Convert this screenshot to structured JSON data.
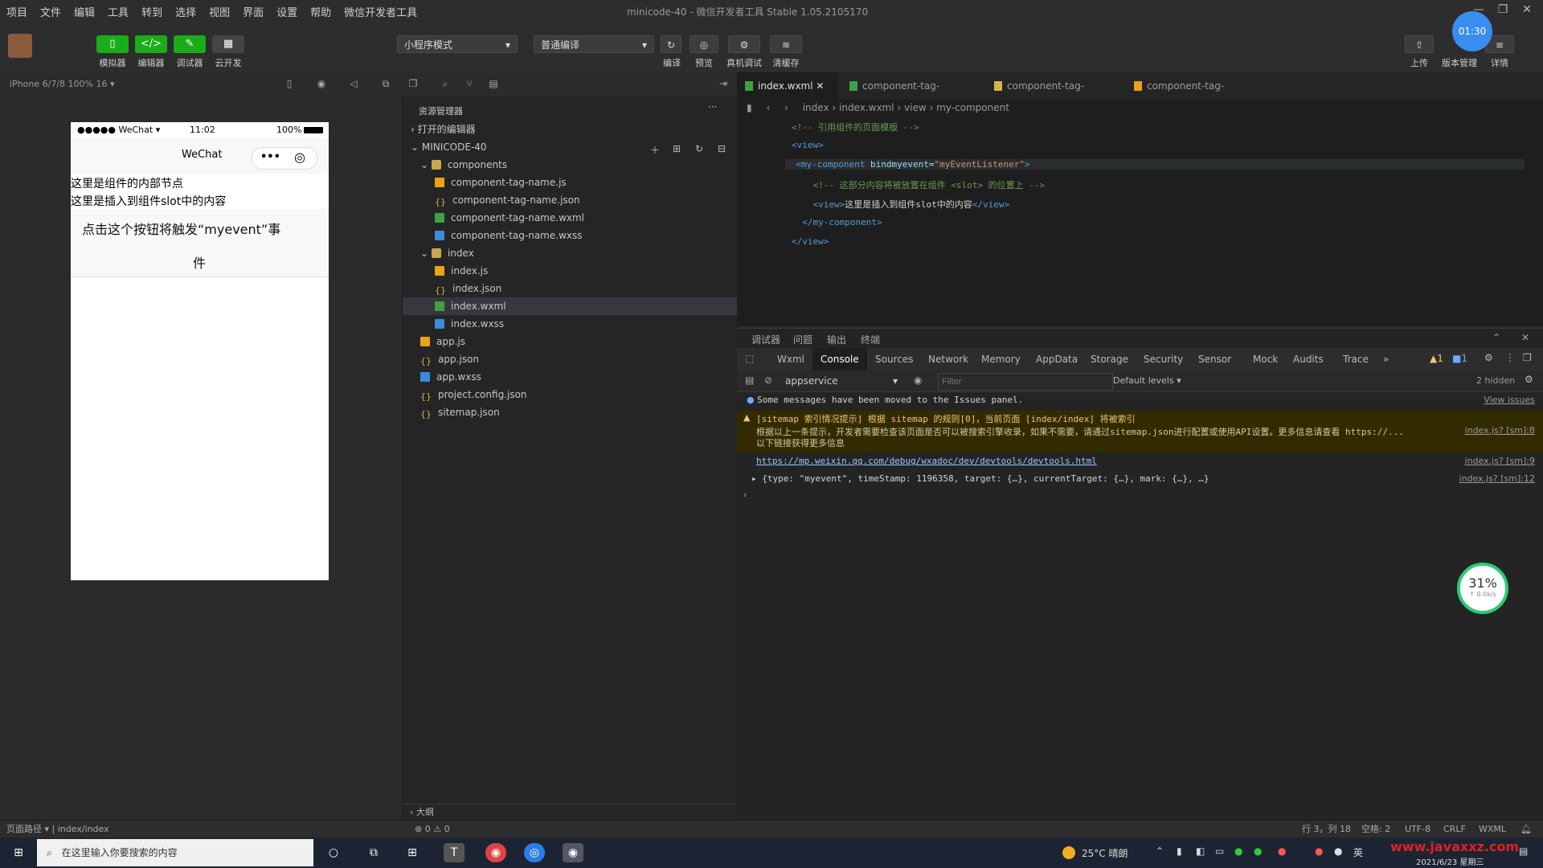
{
  "menubar": {
    "items": [
      "项目",
      "文件",
      "编辑",
      "工具",
      "转到",
      "选择",
      "视图",
      "界面",
      "设置",
      "帮助",
      "微信开发者工具"
    ],
    "window_title": "minicode-40 - 微信开发者工具 Stable 1.05.2105170"
  },
  "toolbar": {
    "buttons": [
      {
        "icon": "phone-icon",
        "label": "模拟器"
      },
      {
        "icon": "code-icon",
        "label": "编辑器"
      },
      {
        "icon": "debug-icon",
        "label": "调试器"
      },
      {
        "icon": "cloud-icon",
        "label": "云开发"
      }
    ],
    "mode_select": "小程序模式",
    "compile_select": "普通编译",
    "compile_label": "编译",
    "preview_label": "预览",
    "real_debug_label": "真机调试",
    "clear_cache_label": "清缓存",
    "upload_label": "上传",
    "version_label": "版本管理",
    "detail_label": "详情",
    "avatar_time": "01:30"
  },
  "subbar": {
    "device": "iPhone 6/7/8 100% 16 ▾"
  },
  "simulator": {
    "status_left": "●●●●● WeChat ▾",
    "status_time": "11:02",
    "status_right": "100%",
    "nav_title": "WeChat",
    "line1": "这里是组件的内部节点",
    "line2": "这里是插入到组件slot中的内容",
    "button_text_1": "点击这个按钮将触发“myevent”事",
    "button_text_2": "件"
  },
  "explorer": {
    "header": "资源管理器",
    "open_editors": "打开的编辑器",
    "project": "MINICODE-40",
    "tree": [
      {
        "label": "components",
        "type": "folder",
        "depth": 1
      },
      {
        "label": "component-tag-name.js",
        "type": "js",
        "depth": 2
      },
      {
        "label": "component-tag-name.json",
        "type": "json",
        "depth": 2
      },
      {
        "label": "component-tag-name.wxml",
        "type": "wxml",
        "depth": 2
      },
      {
        "label": "component-tag-name.wxss",
        "type": "wxss",
        "depth": 2
      },
      {
        "label": "index",
        "type": "folder",
        "depth": 1
      },
      {
        "label": "index.js",
        "type": "js",
        "depth": 2
      },
      {
        "label": "index.json",
        "type": "json",
        "depth": 2
      },
      {
        "label": "index.wxml",
        "type": "wxml",
        "depth": 2,
        "selected": true
      },
      {
        "label": "index.wxss",
        "type": "wxss",
        "depth": 2
      },
      {
        "label": "app.js",
        "type": "js",
        "depth": 1
      },
      {
        "label": "app.json",
        "type": "json",
        "depth": 1
      },
      {
        "label": "app.wxss",
        "type": "wxss",
        "depth": 1
      },
      {
        "label": "project.config.json",
        "type": "json",
        "depth": 1
      },
      {
        "label": "sitemap.json",
        "type": "json",
        "depth": 1
      }
    ],
    "outline": "大纲"
  },
  "editor": {
    "tabs": [
      {
        "label": "index.wxml",
        "type": "wxml",
        "active": true
      },
      {
        "label": "component-tag-name.wxml",
        "type": "wxml"
      },
      {
        "label": "component-tag-name.json",
        "type": "json"
      },
      {
        "label": "component-tag-name.js",
        "type": "js"
      }
    ],
    "breadcrumb": [
      "index",
      "index.wxml",
      "view",
      "my-component"
    ],
    "lines": [
      [
        {
          "t": "<!-- 引用组件的页面模版 -->",
          "c": "com"
        }
      ],
      [
        {
          "t": "<view>",
          "c": "tag"
        }
      ],
      [
        {
          "t": "  <my-component ",
          "c": "tag"
        },
        {
          "t": "bindmyevent",
          "c": "attr"
        },
        {
          "t": "=",
          "c": "txt"
        },
        {
          "t": "\"myEventListener\"",
          "c": "str"
        },
        {
          "t": ">",
          "c": "tag"
        }
      ],
      [
        {
          "t": "    <!-- 这部分内容将被放置在组件 <slot> 的位置上 -->",
          "c": "com"
        }
      ],
      [
        {
          "t": "    <view>",
          "c": "tag"
        },
        {
          "t": "这里是插入到组件slot中的内容",
          "c": "txt"
        },
        {
          "t": "</view>",
          "c": "tag"
        }
      ],
      [
        {
          "t": "  </my-component>",
          "c": "tag"
        }
      ],
      [
        {
          "t": "</view>",
          "c": "tag"
        }
      ]
    ]
  },
  "devtools": {
    "head_tabs": [
      "调试器",
      "问题",
      "输出",
      "终端"
    ],
    "tabs": [
      "Wxml",
      "Console",
      "Sources",
      "Network",
      "Memory",
      "AppData",
      "Storage",
      "Security",
      "Sensor",
      "Mock",
      "Audits",
      "Trace",
      "»"
    ],
    "active_tab": "Console",
    "warning_count": "1",
    "info_count": "1",
    "context": "appservice",
    "filter_placeholder": "Filter",
    "levels": "Default levels ▾",
    "hidden": "2 hidden",
    "messages": {
      "info": "Some messages have been moved to the Issues panel.",
      "view_issues": "View issues",
      "warn_title": "[sitemap 索引情况提示] 根据 sitemap 的规则[0]，当前页面 [index/index] 将被索引",
      "warn_body": "根据以上一条提示，开发者需要检查该页面是否可以被搜索引擎收录，如果不需要，请通过sitemap.json进行配置或使用API设置。更多信息请查看 https://...",
      "warn_body2": "以下链接获得更多信息",
      "warn_src": "index.js? [sm]:8",
      "link": "https://mp.weixin.qq.com/debug/wxadoc/dev/devtools/devtools.html",
      "link_src": "index.js? [sm]:9",
      "log": "▸ {type: \"myevent\", timeStamp: 1196358, target: {…}, currentTarget: {…}, mark: {…}, …}",
      "log_src": "index.js? [sm]:12",
      "prompt": "›"
    }
  },
  "statusbar": {
    "left": "页面路径 ▾  |  index/index",
    "middle": "⊗ 0 ⚠ 0",
    "right": [
      "行 3，列 18",
      "空格: 2",
      "UTF-8",
      "CRLF",
      "WXML"
    ]
  },
  "taskbar": {
    "search_placeholder": "在这里输入你要搜索的内容",
    "weather": "25°C 晴朗",
    "date": "2021/6/23 星期三",
    "watermark": "www.javaxxz.com"
  },
  "float_badge": {
    "percent": "31%",
    "sub": "↑ 0.0k/s"
  }
}
